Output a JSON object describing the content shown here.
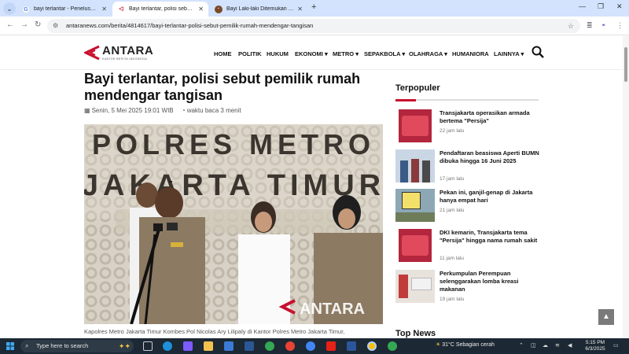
{
  "browser": {
    "tabs": [
      {
        "title": "bayi terlantar - Penelusuran Go",
        "favicon": "google-icon",
        "active": false
      },
      {
        "title": "Bayi terlantar, polisi sebut pemi",
        "favicon": "antara-icon",
        "active": true
      },
      {
        "title": "Bayi Laki-laki Ditemukan Terlan",
        "favicon": "news-icon",
        "active": false
      }
    ],
    "url": "antaranews.com/berita/4814617/bayi-terlantar-polisi-sebut-pemilik-rumah-mendengar-tangisan"
  },
  "site": {
    "logo_text": "ANTARA",
    "logo_sub": "KANTOR BERITA INDONESIA",
    "nav": [
      {
        "label": "HOME",
        "dropdown": false
      },
      {
        "label": "POLITIK",
        "dropdown": false
      },
      {
        "label": "HUKUM",
        "dropdown": false
      },
      {
        "label": "EKONOMI",
        "dropdown": true
      },
      {
        "label": "METRO",
        "dropdown": true
      },
      {
        "label": "SEPAKBOLA",
        "dropdown": true
      },
      {
        "label": "OLAHRAGA",
        "dropdown": true
      },
      {
        "label": "HUMANIORA",
        "dropdown": false
      },
      {
        "label": "LAINNYA",
        "dropdown": true
      }
    ]
  },
  "article": {
    "headline": "Bayi terlantar, polisi sebut pemilik rumah mendengar tangisan",
    "date": "Senin, 5 Mei 2025 19:01 WIB",
    "read_time": "waktu baca 3 menit",
    "photo_sign_line1": "POLRES METRO",
    "photo_sign_line2": "JAKARTA TIMUR",
    "photo_watermark": "ANTARA",
    "caption": "Kapolres Metro Jakarta Timur Kombes Pol Nicolas Ary Lilipaly di Kantor Polres Metro Jakarta Timur,"
  },
  "sidebar": {
    "title": "Terpopuler",
    "items": [
      {
        "title": "Transjakarta operasikan armada bertema \"Persija\"",
        "time": "22 jam lalu"
      },
      {
        "title": "Pendaftaran beasiswa Aperti BUMN dibuka hingga 16 Juni 2025",
        "time": "17 jam lalu"
      },
      {
        "title": "Pekan ini, ganjil-genap di Jakarta hanya empat hari",
        "time": "21 jam lalu"
      },
      {
        "title": "DKI kemarin, Transjakarta tema \"Persija\" hingga nama rumah sakit",
        "time": "11 jam lalu"
      },
      {
        "title": "Perkumpulan Perempuan selenggarakan lomba kreasi makanan",
        "time": "19 jam lalu"
      }
    ],
    "top_news": "Top News"
  },
  "taskbar": {
    "search_placeholder": "Type here to search",
    "weather": "31°C  Sebagian cerah",
    "time": "5:15 PM",
    "date": "6/3/2025"
  },
  "colors": {
    "accent": "#c8102e",
    "taskbar": "#1c2833",
    "tab_strip": "#d3e3fd"
  }
}
